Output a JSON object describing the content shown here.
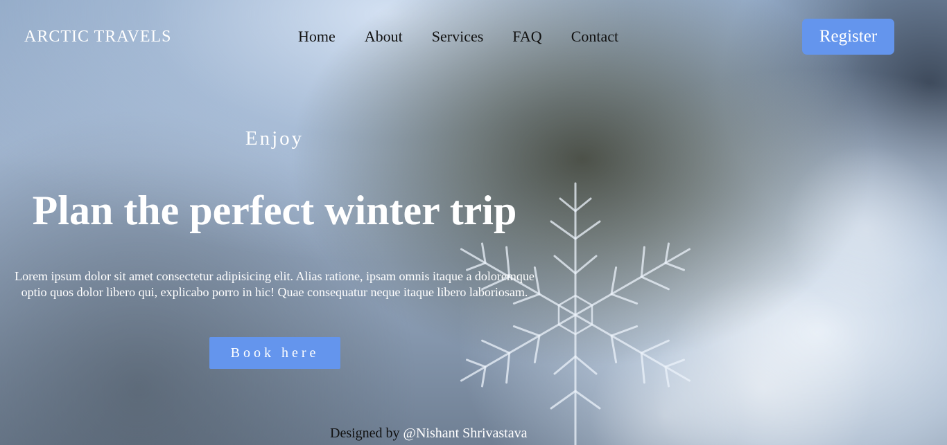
{
  "header": {
    "logo": "ARCTIC TRAVELS",
    "nav": [
      "Home",
      "About",
      "Services",
      "FAQ",
      "Contact"
    ],
    "register_label": "Register"
  },
  "hero": {
    "eyebrow": "Enjoy",
    "headline": "Plan the perfect winter trip",
    "description": "Lorem ipsum dolor sit amet consectetur adipisicing elit. Alias ratione, ipsam omnis itaque a doloremque optio quos dolor libero qui, explicabo porro in hic! Quae consequatur neque itaque libero laboriosam.",
    "cta_label": "Book here"
  },
  "footer": {
    "prefix": "Designed by ",
    "author": "@Nishant Shrivastava"
  },
  "colors": {
    "accent": "#6495ed",
    "hero_text": "#ffffff",
    "nav_text": "#111111"
  },
  "background_image": "snowflake-closeup"
}
